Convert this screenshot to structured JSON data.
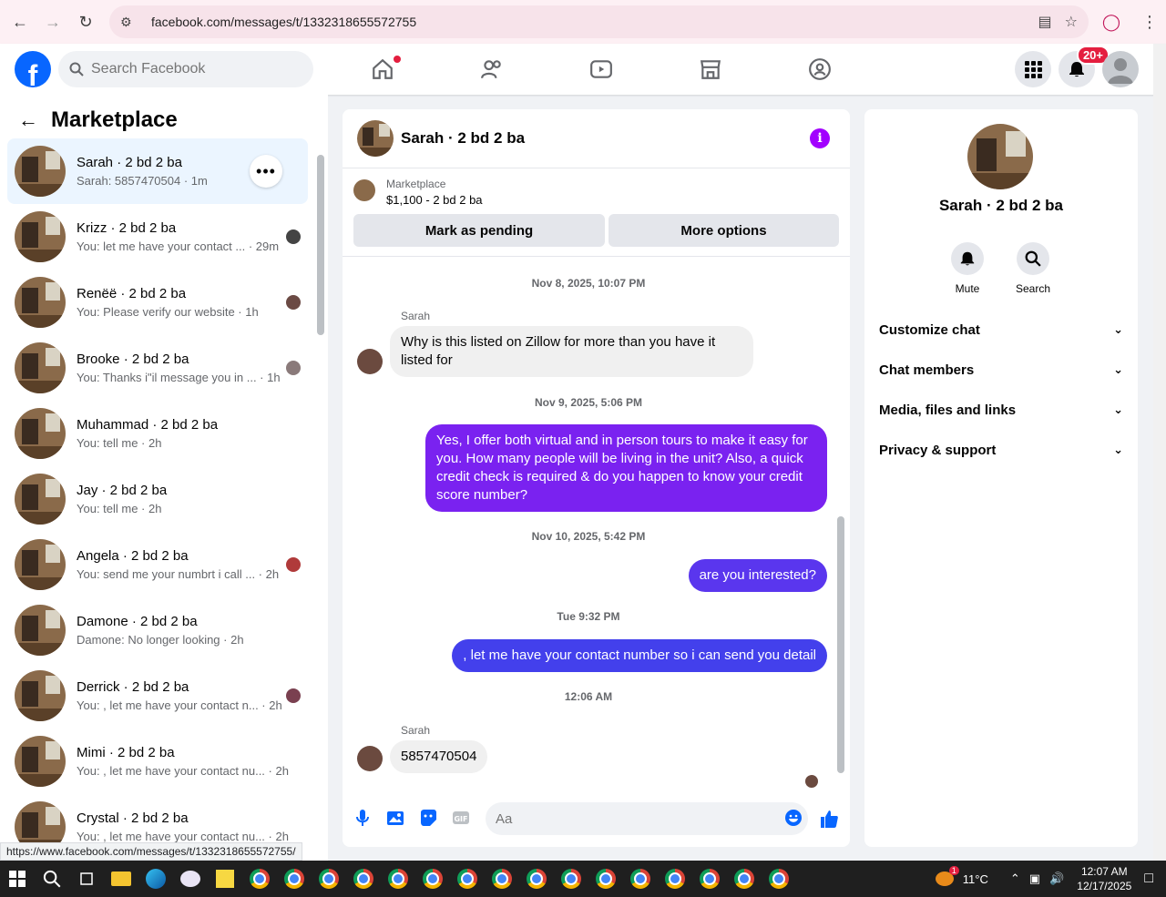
{
  "browser": {
    "url": "facebook.com/messages/t/1332318655572755",
    "status_url": "https://www.facebook.com/messages/t/1332318655572755/"
  },
  "header": {
    "logo_letter": "f",
    "search_placeholder": "Search Facebook",
    "notification_badge": "20+",
    "brand_color": "#0866ff"
  },
  "sidebar": {
    "title": "Marketplace",
    "conversations": [
      {
        "name": "Sarah · 2 bd 2 ba",
        "preview": "Sarah: 5857470504 · 1m"
      },
      {
        "name": "Krizz · 2 bd 2 ba",
        "preview": "You: let me have your contact ... · 29m"
      },
      {
        "name": "Renëë · 2 bd 2 ba",
        "preview": "You: Please verify our website · 1h"
      },
      {
        "name": "Brooke · 2 bd 2 ba",
        "preview": "You: Thanks i\"il message you in ... · 1h"
      },
      {
        "name": "Muhammad · 2 bd 2 ba",
        "preview": "You: tell me · 2h"
      },
      {
        "name": "Jay · 2 bd 2 ba",
        "preview": "You: tell me · 2h"
      },
      {
        "name": "Angela · 2 bd 2 ba",
        "preview": "You: send me your numbrt i call ... · 2h"
      },
      {
        "name": "Damone · 2 bd 2 ba",
        "preview": "Damone: No longer looking · 2h"
      },
      {
        "name": "Derrick · 2 bd 2 ba",
        "preview": "You: , let me have your contact n... · 2h"
      },
      {
        "name": "Mimi · 2 bd 2 ba",
        "preview": "You: , let me have your contact nu... · 2h"
      },
      {
        "name": "Crystal · 2 bd 2 ba",
        "preview": "You: , let me have your contact nu... · 2h"
      }
    ]
  },
  "chat": {
    "title": "Sarah · 2 bd 2 ba",
    "listing_label": "Marketplace",
    "listing_price": "$1,100 - 2 bd 2 ba",
    "mark_pending": "Mark as pending",
    "more_options": "More options",
    "ts1": "Nov 8, 2025, 10:07 PM",
    "sender1": "Sarah",
    "msg1": "Why is this listed on Zillow for more than you have it listed for",
    "ts2": "Nov 9, 2025, 5:06 PM",
    "msg2": "Yes, I offer both virtual and in person tours to make it easy for you. How many people will be living in the unit? Also, a quick credit check is required & do you happen to know your credit score number?",
    "ts3": "Nov 10, 2025, 5:42 PM",
    "msg3": "are you interested?",
    "ts4": "Tue 9:32 PM",
    "msg4": ", let me have your contact number so i can send you detail",
    "ts5": "12:06 AM",
    "sender2": "Sarah",
    "msg5": "5857470504",
    "composer_placeholder": "Aa",
    "outgoing_colors": [
      "#7a22f0",
      "#5a36ee",
      "#4340ec"
    ]
  },
  "right": {
    "name": "Sarah · 2 bd 2 ba",
    "mute": "Mute",
    "search": "Search",
    "sections": [
      "Customize chat",
      "Chat members",
      "Media, files and links",
      "Privacy & support"
    ]
  },
  "taskbar": {
    "temp": "11°C",
    "time": "12:07 AM",
    "date": "12/17/2025",
    "weather_badge": "1"
  }
}
